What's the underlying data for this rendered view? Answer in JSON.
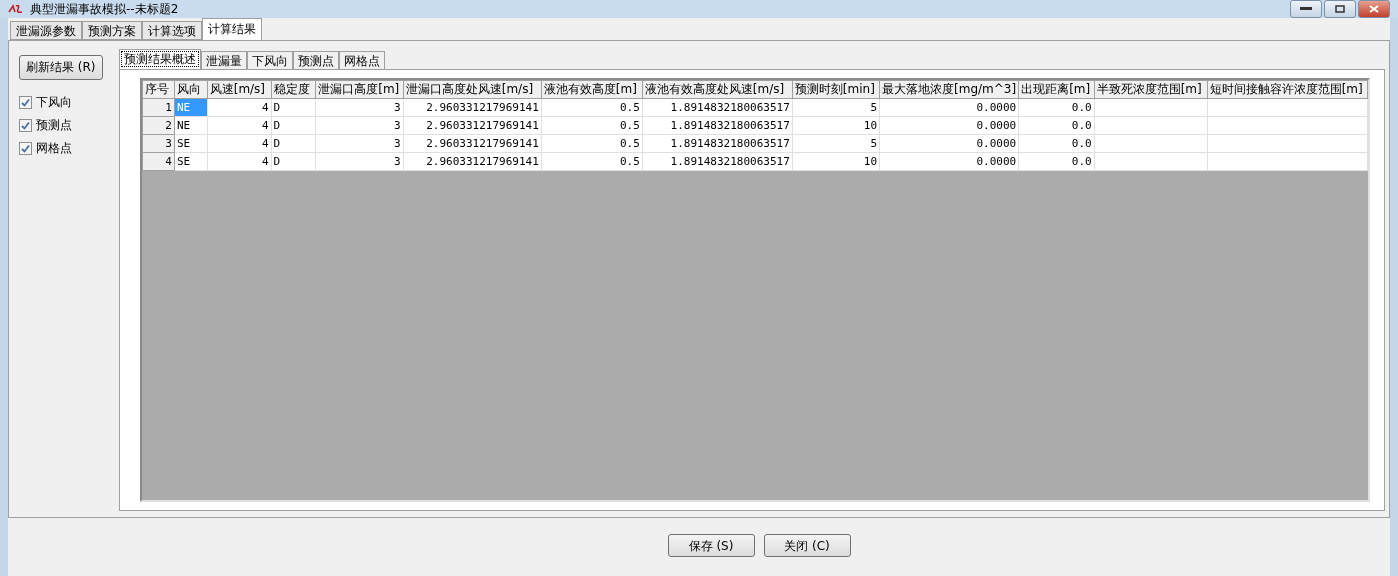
{
  "window": {
    "title": "典型泄漏事故模拟--未标题2"
  },
  "tabs": [
    {
      "label": "泄漏源参数",
      "selected": false
    },
    {
      "label": "预测方案",
      "selected": false
    },
    {
      "label": "计算选项",
      "selected": false
    },
    {
      "label": "计算结果",
      "selected": true
    }
  ],
  "refresh_button": "刷新结果 (R)",
  "checkboxes": [
    {
      "label": "下风向",
      "checked": true
    },
    {
      "label": "预测点",
      "checked": true
    },
    {
      "label": "网格点",
      "checked": true
    }
  ],
  "sub_tabs": [
    {
      "label": "预测结果概述",
      "selected": true
    },
    {
      "label": "泄漏量",
      "selected": false
    },
    {
      "label": "下风向",
      "selected": false
    },
    {
      "label": "预测点",
      "selected": false
    },
    {
      "label": "网格点",
      "selected": false
    }
  ],
  "table": {
    "columns": [
      "序号",
      "风向",
      "风速[m/s]",
      "稳定度",
      "泄漏口高度[m]",
      "泄漏口高度处风速[m/s]",
      "液池有效高度[m]",
      "液池有效高度处风速[m/s]",
      "预测时刻[min]",
      "最大落地浓度[mg/m^3]",
      "出现距离[m]",
      "半致死浓度范围[m]",
      "短时间接触容许浓度范围[m]"
    ],
    "rows": [
      {
        "selected": true,
        "cells": [
          "1",
          "NE",
          "4",
          "D",
          "3",
          "2.960331217969141",
          "0.5",
          "1.8914832180063517",
          "5",
          "0.0000",
          "0.0"
        ]
      },
      {
        "selected": false,
        "cells": [
          "2",
          "NE",
          "4",
          "D",
          "3",
          "2.960331217969141",
          "0.5",
          "1.8914832180063517",
          "10",
          "0.0000",
          "0.0"
        ]
      },
      {
        "selected": false,
        "cells": [
          "3",
          "SE",
          "4",
          "D",
          "3",
          "2.960331217969141",
          "0.5",
          "1.8914832180063517",
          "5",
          "0.0000",
          "0.0"
        ]
      },
      {
        "selected": false,
        "cells": [
          "4",
          "SE",
          "4",
          "D",
          "3",
          "2.960331217969141",
          "0.5",
          "1.8914832180063517",
          "10",
          "0.0000",
          "0.0"
        ]
      }
    ]
  },
  "buttons": [
    "保存 (S)",
    "关闭 (C)"
  ]
}
